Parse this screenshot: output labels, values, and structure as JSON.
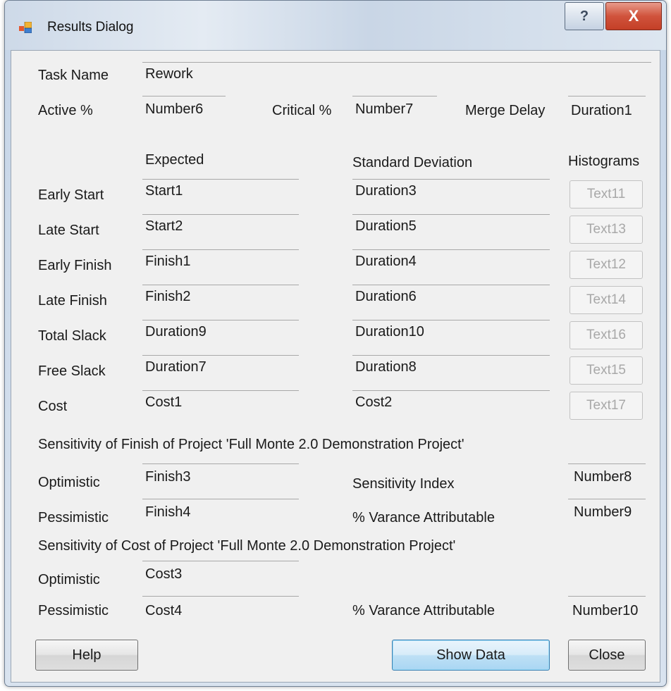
{
  "window": {
    "title": "Results Dialog",
    "help_glyph": "?",
    "close_glyph": "X"
  },
  "task": {
    "label": "Task Name",
    "value": "Rework"
  },
  "top_row": {
    "active_label": "Active %",
    "active_value": "Number6",
    "critical_label": "Critical %",
    "critical_value": "Number7",
    "merge_label": "Merge Delay",
    "merge_value": "Duration1"
  },
  "grid": {
    "headers": {
      "expected": "Expected",
      "stddev": "Standard Deviation",
      "histograms": "Histograms"
    },
    "rows": [
      {
        "label": "Early Start",
        "expected": "Start1",
        "stddev": "Duration3",
        "hist": "Text11"
      },
      {
        "label": "Late Start",
        "expected": "Start2",
        "stddev": "Duration5",
        "hist": "Text13"
      },
      {
        "label": "Early Finish",
        "expected": "Finish1",
        "stddev": "Duration4",
        "hist": "Text12"
      },
      {
        "label": "Late Finish",
        "expected": "Finish2",
        "stddev": "Duration6",
        "hist": "Text14"
      },
      {
        "label": "Total Slack",
        "expected": "Duration9",
        "stddev": "Duration10",
        "hist": "Text16"
      },
      {
        "label": "Free Slack",
        "expected": "Duration7",
        "stddev": "Duration8",
        "hist": "Text15"
      },
      {
        "label": "Cost",
        "expected": "Cost1",
        "stddev": "Cost2",
        "hist": "Text17"
      }
    ]
  },
  "sens_finish": {
    "heading": "Sensitivity of Finish of Project 'Full Monte 2.0 Demonstration Project'",
    "optimistic_label": "Optimistic",
    "optimistic_value": "Finish3",
    "pessimistic_label": "Pessimistic",
    "pessimistic_value": "Finish4",
    "index_label": "Sensitivity Index",
    "index_value": "Number8",
    "variance_label": "% Varance Attributable",
    "variance_value": "Number9"
  },
  "sens_cost": {
    "heading": "Sensitivity of Cost of Project 'Full Monte 2.0 Demonstration Project'",
    "optimistic_label": "Optimistic",
    "optimistic_value": "Cost3",
    "pessimistic_label": "Pessimistic",
    "pessimistic_value": "Cost4",
    "variance_label": "% Varance Attributable",
    "variance_value": "Number10"
  },
  "buttons": {
    "help": "Help",
    "show_data": "Show Data",
    "close": "Close"
  },
  "colors": {
    "titlebar": "#c9d6e6",
    "client_bg": "#f0f0f0",
    "close_red": "#c43f27",
    "default_button": "#a9d6f3"
  },
  "icons": {
    "app": "app-window-icon"
  }
}
